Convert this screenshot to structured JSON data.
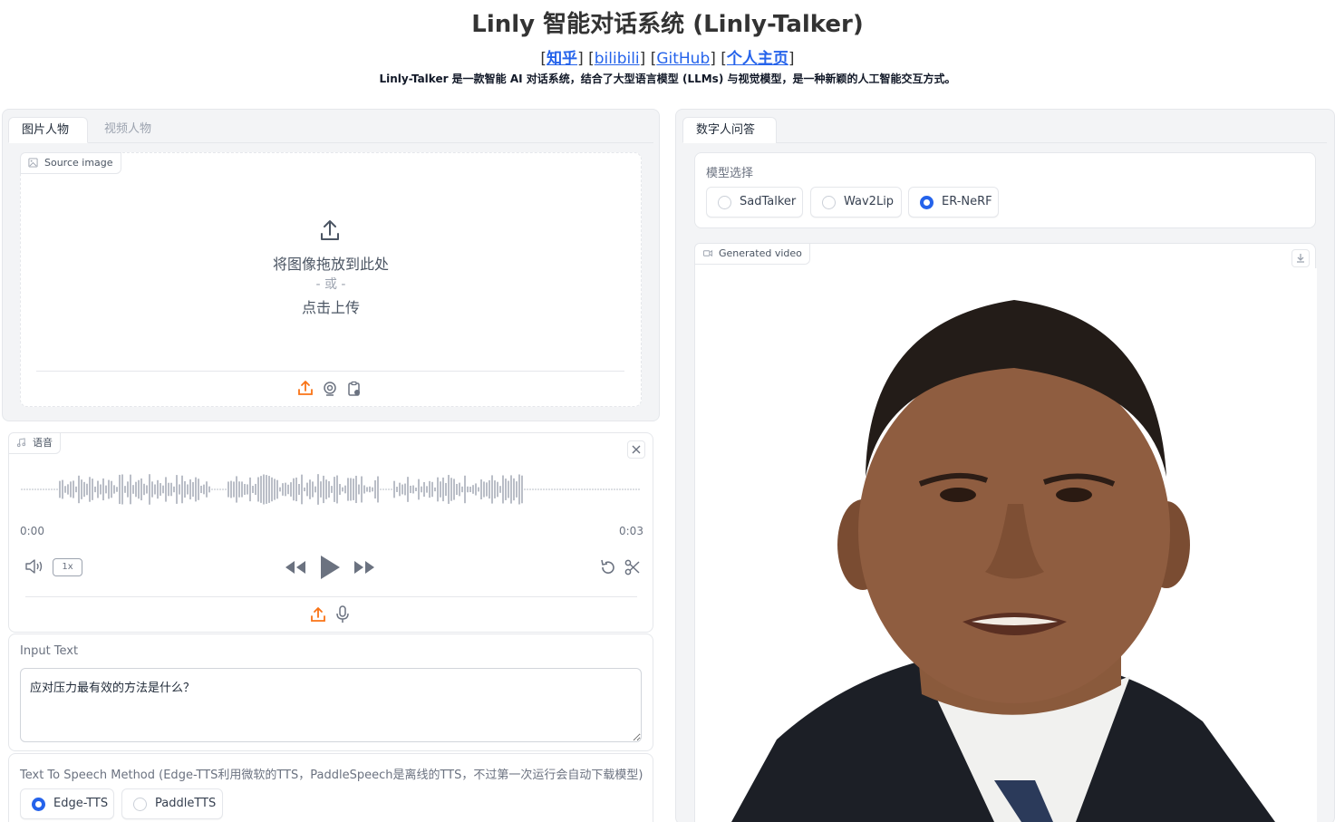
{
  "header": {
    "title": "Linly 智能对话系统 (Linly-Talker)",
    "links": [
      {
        "label": "知乎",
        "bold": true
      },
      {
        "label": "bilibili",
        "bold": false
      },
      {
        "label": "GitHub",
        "bold": false
      },
      {
        "label": "个人主页",
        "bold": true
      }
    ],
    "description": "Linly-Talker 是一款智能 AI 对话系统，结合了大型语言模型 (LLMs) 与视觉模型，是一种新颖的人工智能交互方式。"
  },
  "left": {
    "tabs": [
      "图片人物",
      "视频人物"
    ],
    "active_tab": 0,
    "source_image": {
      "label": "Source image",
      "drop_text": "将图像拖放到此处",
      "or_text": "- 或 -",
      "click_text": "点击上传"
    },
    "audio": {
      "label": "语音",
      "time_start": "0:00",
      "time_end": "0:03",
      "playback_rate": "1x"
    },
    "input_text": {
      "label": "Input Text",
      "value": "应对压力最有效的方法是什么？"
    },
    "tts": {
      "label": "Text To Speech Method (Edge-TTS利用微软的TTS，PaddleSpeech是离线的TTS，不过第一次运行会自动下载模型)",
      "options": [
        "Edge-TTS",
        "PaddleTTS"
      ],
      "selected": "Edge-TTS"
    }
  },
  "right": {
    "tabs": [
      "数字人问答"
    ],
    "model": {
      "label": "模型选择",
      "options": [
        "SadTalker",
        "Wav2Lip",
        "ER-NeRF"
      ],
      "selected": "ER-NeRF"
    },
    "video": {
      "label": "Generated video"
    }
  },
  "colors": {
    "accent": "#2563eb",
    "upload_orange": "#f97316",
    "panel_bg": "#f3f4f6",
    "border": "#e5e7eb"
  }
}
